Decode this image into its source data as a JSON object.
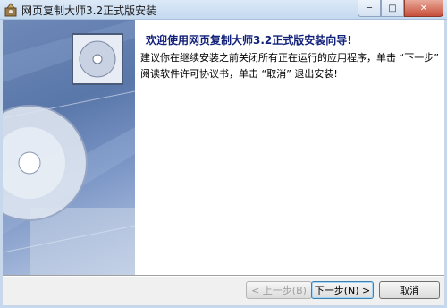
{
  "window": {
    "title": "网页复制大师3.2正式版安装",
    "min_glyph": "─",
    "max_glyph": "□",
    "close_glyph": "✕"
  },
  "main": {
    "heading": "欢迎使用网页复制大师3.2正式版安装向导!",
    "body": "建议你在继续安装之前关闭所有正在运行的应用程序，单击 “下一步” 阅读软件许可协议书，单击 “取消” 退出安装!"
  },
  "buttons": {
    "back": "< 上一步(B)",
    "next": "下一步(N) >",
    "cancel": "取消"
  },
  "colors": {
    "heading": "#12217a",
    "banner": "#5a77aa",
    "close": "#c7503b"
  }
}
